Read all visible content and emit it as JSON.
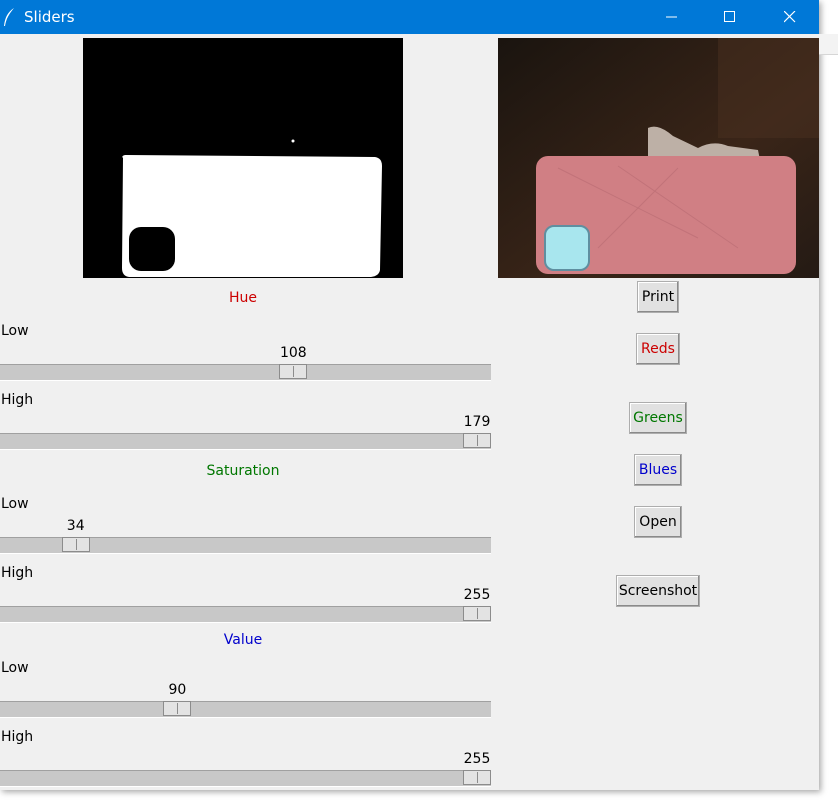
{
  "window": {
    "title": "Sliders"
  },
  "sections": {
    "hue": {
      "title": "Hue",
      "color": "#cc0000",
      "low_label": "Low",
      "high_label": "High",
      "low_value": "108",
      "high_value": "179",
      "range_max": 179
    },
    "saturation": {
      "title": "Saturation",
      "color": "#007700",
      "low_label": "Low",
      "high_label": "High",
      "low_value": "34",
      "high_value": "255",
      "range_max": 255
    },
    "value": {
      "title": "Value",
      "color": "#0000cc",
      "low_label": "Low",
      "high_label": "High",
      "low_value": "90",
      "high_value": "255",
      "range_max": 255
    }
  },
  "buttons": {
    "print": {
      "label": "Print",
      "color": "#000000"
    },
    "reds": {
      "label": "Reds",
      "color": "#cc0000"
    },
    "greens": {
      "label": "Greens",
      "color": "#007700"
    },
    "blues": {
      "label": "Blues",
      "color": "#0000cc"
    },
    "open": {
      "label": "Open",
      "color": "#000000"
    },
    "screenshot": {
      "label": "Screenshot",
      "color": "#000000"
    }
  },
  "icons": {
    "app": "feather-icon",
    "minimize": "minimize-icon",
    "maximize": "maximize-icon",
    "close": "close-icon"
  },
  "colors": {
    "titlebar": "#0078d7",
    "background": "#f0f0f0"
  }
}
